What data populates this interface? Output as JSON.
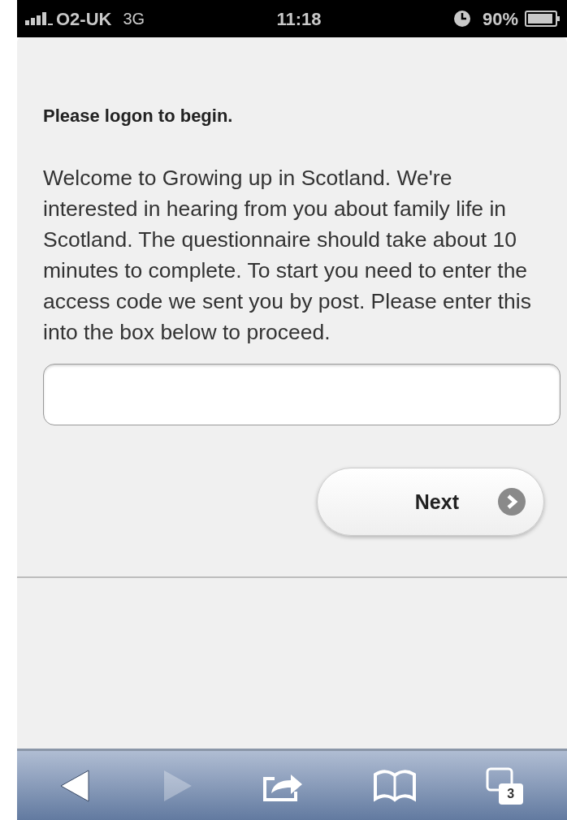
{
  "status_bar": {
    "carrier": "O2-UK",
    "network": "3G",
    "time": "11:18",
    "battery": "90%"
  },
  "heading": "Please logon to begin.",
  "intro": "Welcome to Growing up in Scotland. We're interested in hearing from you about family life in Scotland. The questionnaire should take about 10 minutes to complete. To start you need to enter the access code we sent you by post. Please enter this into the box below to proceed.",
  "next_button": {
    "label": "Next"
  },
  "toolbar": {
    "items": [
      {
        "kind": "back",
        "disabled": false
      },
      {
        "kind": "forward",
        "disabled": true
      },
      {
        "kind": "share",
        "disabled": false
      },
      {
        "kind": "bookmarks",
        "disabled": false
      },
      {
        "kind": "tabs",
        "disabled": false,
        "count": "3"
      }
    ]
  }
}
